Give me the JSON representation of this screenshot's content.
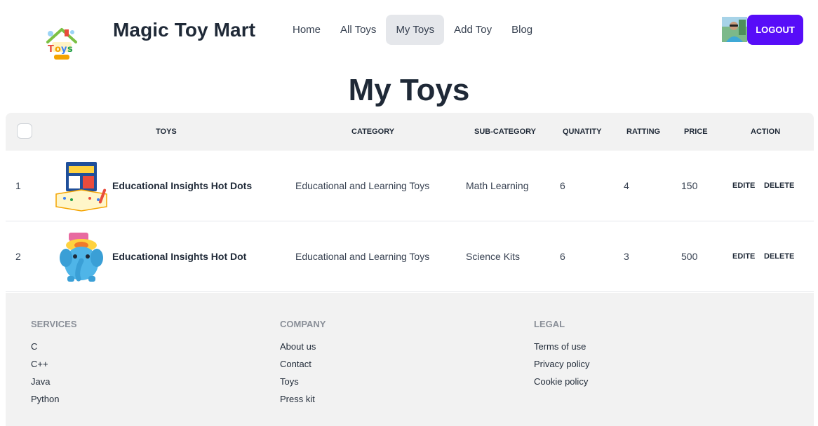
{
  "brand": {
    "name": "Magic Toy Mart",
    "logo_icon": "toys-house-logo-icon"
  },
  "nav": [
    {
      "label": "Home",
      "active": false
    },
    {
      "label": "All Toys",
      "active": false
    },
    {
      "label": "My Toys",
      "active": true
    },
    {
      "label": "Add Toy",
      "active": false
    },
    {
      "label": "Blog",
      "active": false
    }
  ],
  "user": {
    "avatar_icon": "user-avatar",
    "logout_label": "LOGOUT"
  },
  "page": {
    "title": "My Toys"
  },
  "table": {
    "headers": {
      "toys": "Toys",
      "category": "Category",
      "subcategory": "Sub-Category",
      "quantity": "Qunatity",
      "rating": "Ratting",
      "price": "Price",
      "action": "Action"
    },
    "rows": [
      {
        "index": "1",
        "name": "Educational Insights Hot Dots",
        "category": "Educational and Learning Toys",
        "subcategory": "Math Learning",
        "quantity": "6",
        "rating": "4",
        "price": "150",
        "edit_label": "EDITE",
        "delete_label": "DELETE",
        "image_icon": "hot-dots-book-image"
      },
      {
        "index": "2",
        "name": "Educational Insights Hot Dot",
        "category": "Educational and Learning Toys",
        "subcategory": "Science Kits",
        "quantity": "6",
        "rating": "3",
        "price": "500",
        "edit_label": "EDITE",
        "delete_label": "DELETE",
        "image_icon": "blue-elephant-toy-image"
      }
    ]
  },
  "footer": {
    "services": {
      "title": "Services",
      "links": [
        "C",
        "C++",
        "Java",
        "Python"
      ]
    },
    "company": {
      "title": "Company",
      "links": [
        "About us",
        "Contact",
        "Toys",
        "Press kit"
      ]
    },
    "legal": {
      "title": "Legal",
      "links": [
        "Terms of use",
        "Privacy policy",
        "Cookie policy"
      ]
    }
  },
  "colors": {
    "accent": "#570df8",
    "header_bg": "#f2f2f2",
    "text": "#1f2937",
    "muted": "#8a8f98"
  }
}
